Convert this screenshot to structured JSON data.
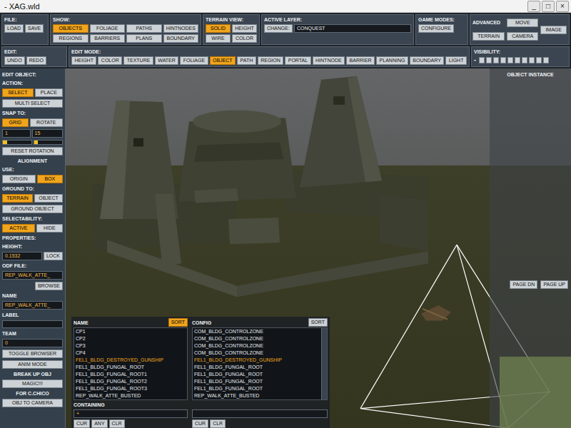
{
  "window": {
    "title": "- XAG.wld",
    "controls": [
      "_",
      "□",
      "×"
    ]
  },
  "toolbar": {
    "file": {
      "label": "FILE:",
      "buttons": [
        {
          "label": "LOAD",
          "selected": false
        },
        {
          "label": "SAVE",
          "selected": false
        }
      ]
    },
    "show": {
      "label": "SHOW:",
      "buttons": [
        {
          "label": "OBJECTS",
          "selected": true
        },
        {
          "label": "FOLIAGE",
          "selected": false
        },
        {
          "label": "PATHS",
          "selected": false
        },
        {
          "label": "HINTNODES",
          "selected": false
        },
        {
          "label": "REGIONS",
          "selected": false
        },
        {
          "label": "BARRIERS",
          "selected": false
        },
        {
          "label": "PLANS",
          "selected": false
        },
        {
          "label": "BOUNDARY",
          "selected": false
        }
      ]
    },
    "terrain_view": {
      "label": "TERRAIN VIEW:",
      "buttons": [
        {
          "label": "SOLID",
          "selected": true
        },
        {
          "label": "HEIGHT",
          "selected": false
        },
        {
          "label": "WIRE",
          "selected": false
        },
        {
          "label": "COLOR",
          "selected": false
        }
      ]
    },
    "active_layer": {
      "label": "ACTIVE LAYER:",
      "button": {
        "label": "CHANGE:",
        "selected": false
      },
      "value": "CONQUEST"
    },
    "game_modes": {
      "label": "GAME MODES:",
      "buttons": [
        {
          "label": "CONFIGURE",
          "selected": false
        }
      ]
    },
    "advanced": {
      "label": "ADVANCED",
      "buttons": [
        {
          "label": "TERRAIN",
          "selected": false
        },
        {
          "label": "MOVE",
          "selected": false
        },
        {
          "label": "CAMERA",
          "selected": false
        },
        {
          "label": "IMAGE",
          "selected": false
        }
      ]
    },
    "edit": {
      "label": "EDIT:",
      "buttons": [
        {
          "label": "UNDO",
          "selected": false
        },
        {
          "label": "REDO",
          "selected": false
        }
      ]
    },
    "edit_mode": {
      "label": "EDIT MODE:",
      "buttons": [
        {
          "label": "HEIGHT",
          "selected": false
        },
        {
          "label": "COLOR",
          "selected": false
        },
        {
          "label": "TEXTURE",
          "selected": false
        },
        {
          "label": "WATER",
          "selected": false
        },
        {
          "label": "FOLIAGE",
          "selected": false
        },
        {
          "label": "OBJECT",
          "selected": true
        },
        {
          "label": "PATH",
          "selected": false
        },
        {
          "label": "REGION",
          "selected": false
        },
        {
          "label": "PORTAL",
          "selected": false
        },
        {
          "label": "HINTNODE",
          "selected": false
        },
        {
          "label": "BARRIER",
          "selected": false
        },
        {
          "label": "PLANNING",
          "selected": false
        },
        {
          "label": "BOUNDARY",
          "selected": false
        },
        {
          "label": "LIGHT",
          "selected": false
        }
      ]
    },
    "visibility": {
      "label": "VISIBILITY:",
      "minus": "-",
      "level": 0
    }
  },
  "left_panel": {
    "items": [
      {
        "kind": "heading",
        "text": "EDIT OBJECT:"
      },
      {
        "kind": "heading",
        "text": "ACTION:"
      },
      {
        "kind": "buttons",
        "buttons": [
          {
            "label": "SELECT",
            "selected": true
          },
          {
            "label": "PLACE",
            "selected": false
          }
        ]
      },
      {
        "kind": "buttons",
        "buttons": [
          {
            "label": "MULTI SELECT",
            "selected": false
          }
        ]
      },
      {
        "kind": "heading",
        "text": "SNAP TO:"
      },
      {
        "kind": "buttons",
        "buttons": [
          {
            "label": "GRID",
            "selected": true
          },
          {
            "label": "ROTATE",
            "selected": false
          }
        ]
      },
      {
        "kind": "fields",
        "values": [
          "1",
          "15"
        ]
      },
      {
        "kind": "sliders",
        "levels": [
          0.15,
          0.15
        ]
      },
      {
        "kind": "buttons",
        "buttons": [
          {
            "label": "RESET ROTATION",
            "selected": false
          }
        ]
      },
      {
        "kind": "center",
        "text": "ALIGNMENT"
      },
      {
        "kind": "heading",
        "text": "USE:"
      },
      {
        "kind": "buttons",
        "buttons": [
          {
            "label": "ORIGIN",
            "selected": false
          },
          {
            "label": "BOX",
            "selected": true
          }
        ]
      },
      {
        "kind": "heading",
        "text": "GROUND TO:"
      },
      {
        "kind": "buttons",
        "buttons": [
          {
            "label": "TERRAIN",
            "selected": true
          },
          {
            "label": "OBJECT",
            "selected": false
          }
        ]
      },
      {
        "kind": "buttons",
        "buttons": [
          {
            "label": "GROUND OBJECT",
            "selected": false
          }
        ]
      },
      {
        "kind": "heading",
        "text": "SELECTABILITY:"
      },
      {
        "kind": "buttons",
        "buttons": [
          {
            "label": "ACTIVE",
            "selected": true
          },
          {
            "label": "HIDE",
            "selected": false
          }
        ]
      },
      {
        "kind": "heading",
        "text": "PROPERTIES:"
      },
      {
        "kind": "heading",
        "text": "HEIGHT:"
      },
      {
        "kind": "value-button",
        "value": "0.1532",
        "button": {
          "label": "LOCK",
          "selected": false
        }
      },
      {
        "kind": "heading",
        "text": "ODF FILE:"
      },
      {
        "kind": "field",
        "value": "REP_WALK_ATTE_"
      },
      {
        "kind": "buttons-right",
        "buttons": [
          {
            "label": "BROWSE",
            "selected": false
          }
        ]
      },
      {
        "kind": "heading",
        "text": "NAME"
      },
      {
        "kind": "field",
        "value": "REP_WALK_ATTE_"
      },
      {
        "kind": "heading",
        "text": "LABEL"
      },
      {
        "kind": "field",
        "value": ""
      },
      {
        "kind": "heading",
        "text": "TEAM"
      },
      {
        "kind": "field",
        "value": "0"
      },
      {
        "kind": "buttons",
        "buttons": [
          {
            "label": "TOGGLE BROWSER",
            "selected": false
          }
        ]
      },
      {
        "kind": "buttons",
        "buttons": [
          {
            "label": "ANIM MODE",
            "selected": false
          }
        ]
      },
      {
        "kind": "center",
        "text": "BREAK UP OBJ"
      },
      {
        "kind": "buttons",
        "buttons": [
          {
            "label": "MAGIC!!!",
            "selected": false
          }
        ]
      },
      {
        "kind": "center",
        "text": "FOR C.CHICO"
      },
      {
        "kind": "buttons",
        "buttons": [
          {
            "label": "OBJ TO CAMERA",
            "selected": false
          }
        ]
      }
    ]
  },
  "right_panel": {
    "title": "OBJECT INSTANCE",
    "buttons": [
      {
        "label": "PAGE DN",
        "selected": false
      },
      {
        "label": "PAGE UP",
        "selected": false
      }
    ]
  },
  "object_list": {
    "columns": [
      {
        "label": "NAME",
        "sort": {
          "label": "SORT",
          "selected": true
        }
      },
      {
        "label": "CONFIG",
        "sort": {
          "label": "SORT",
          "selected": false
        }
      }
    ],
    "rows": [
      {
        "name": "CP1",
        "config": "COM_BLDG_CONTROLZONE",
        "selected": false
      },
      {
        "name": "CP2",
        "config": "COM_BLDG_CONTROLZONE",
        "selected": false
      },
      {
        "name": "CP3",
        "config": "COM_BLDG_CONTROLZONE",
        "selected": false
      },
      {
        "name": "CP4",
        "config": "COM_BLDG_CONTROLZONE",
        "selected": false
      },
      {
        "name": "FEL1_BLDG_DESTROYED_GUNSHIP",
        "config": "FEL1_BLDG_DESTROYED_GUNSHIP",
        "selected": true
      },
      {
        "name": "FEL1_BLDG_FUNGAL_ROOT",
        "config": "FEL1_BLDG_FUNGAL_ROOT",
        "selected": false
      },
      {
        "name": "FEL1_BLDG_FUNGAL_ROOT1",
        "config": "FEL1_BLDG_FUNGAL_ROOT",
        "selected": false
      },
      {
        "name": "FEL1_BLDG_FUNGAL_ROOT2",
        "config": "FEL1_BLDG_FUNGAL_ROOT",
        "selected": false
      },
      {
        "name": "FEL1_BLDG_FUNGAL_ROOT3",
        "config": "FEL1_BLDG_FUNGAL_ROOT",
        "selected": false
      },
      {
        "name": "REP_WALK_ATTE_BUSTED",
        "config": "REP_WALK_ATTE_BUSTED",
        "selected": false
      }
    ],
    "containing": {
      "label": "CONTAINING",
      "fields": [
        "+",
        ""
      ]
    },
    "button_groups": [
      [
        {
          "label": "CUR",
          "selected": false
        },
        {
          "label": "ANY",
          "selected": false
        },
        {
          "label": "CLR",
          "selected": false
        }
      ],
      [
        {
          "label": "CUR",
          "selected": false
        },
        {
          "label": "CLR",
          "selected": false
        }
      ]
    ]
  }
}
